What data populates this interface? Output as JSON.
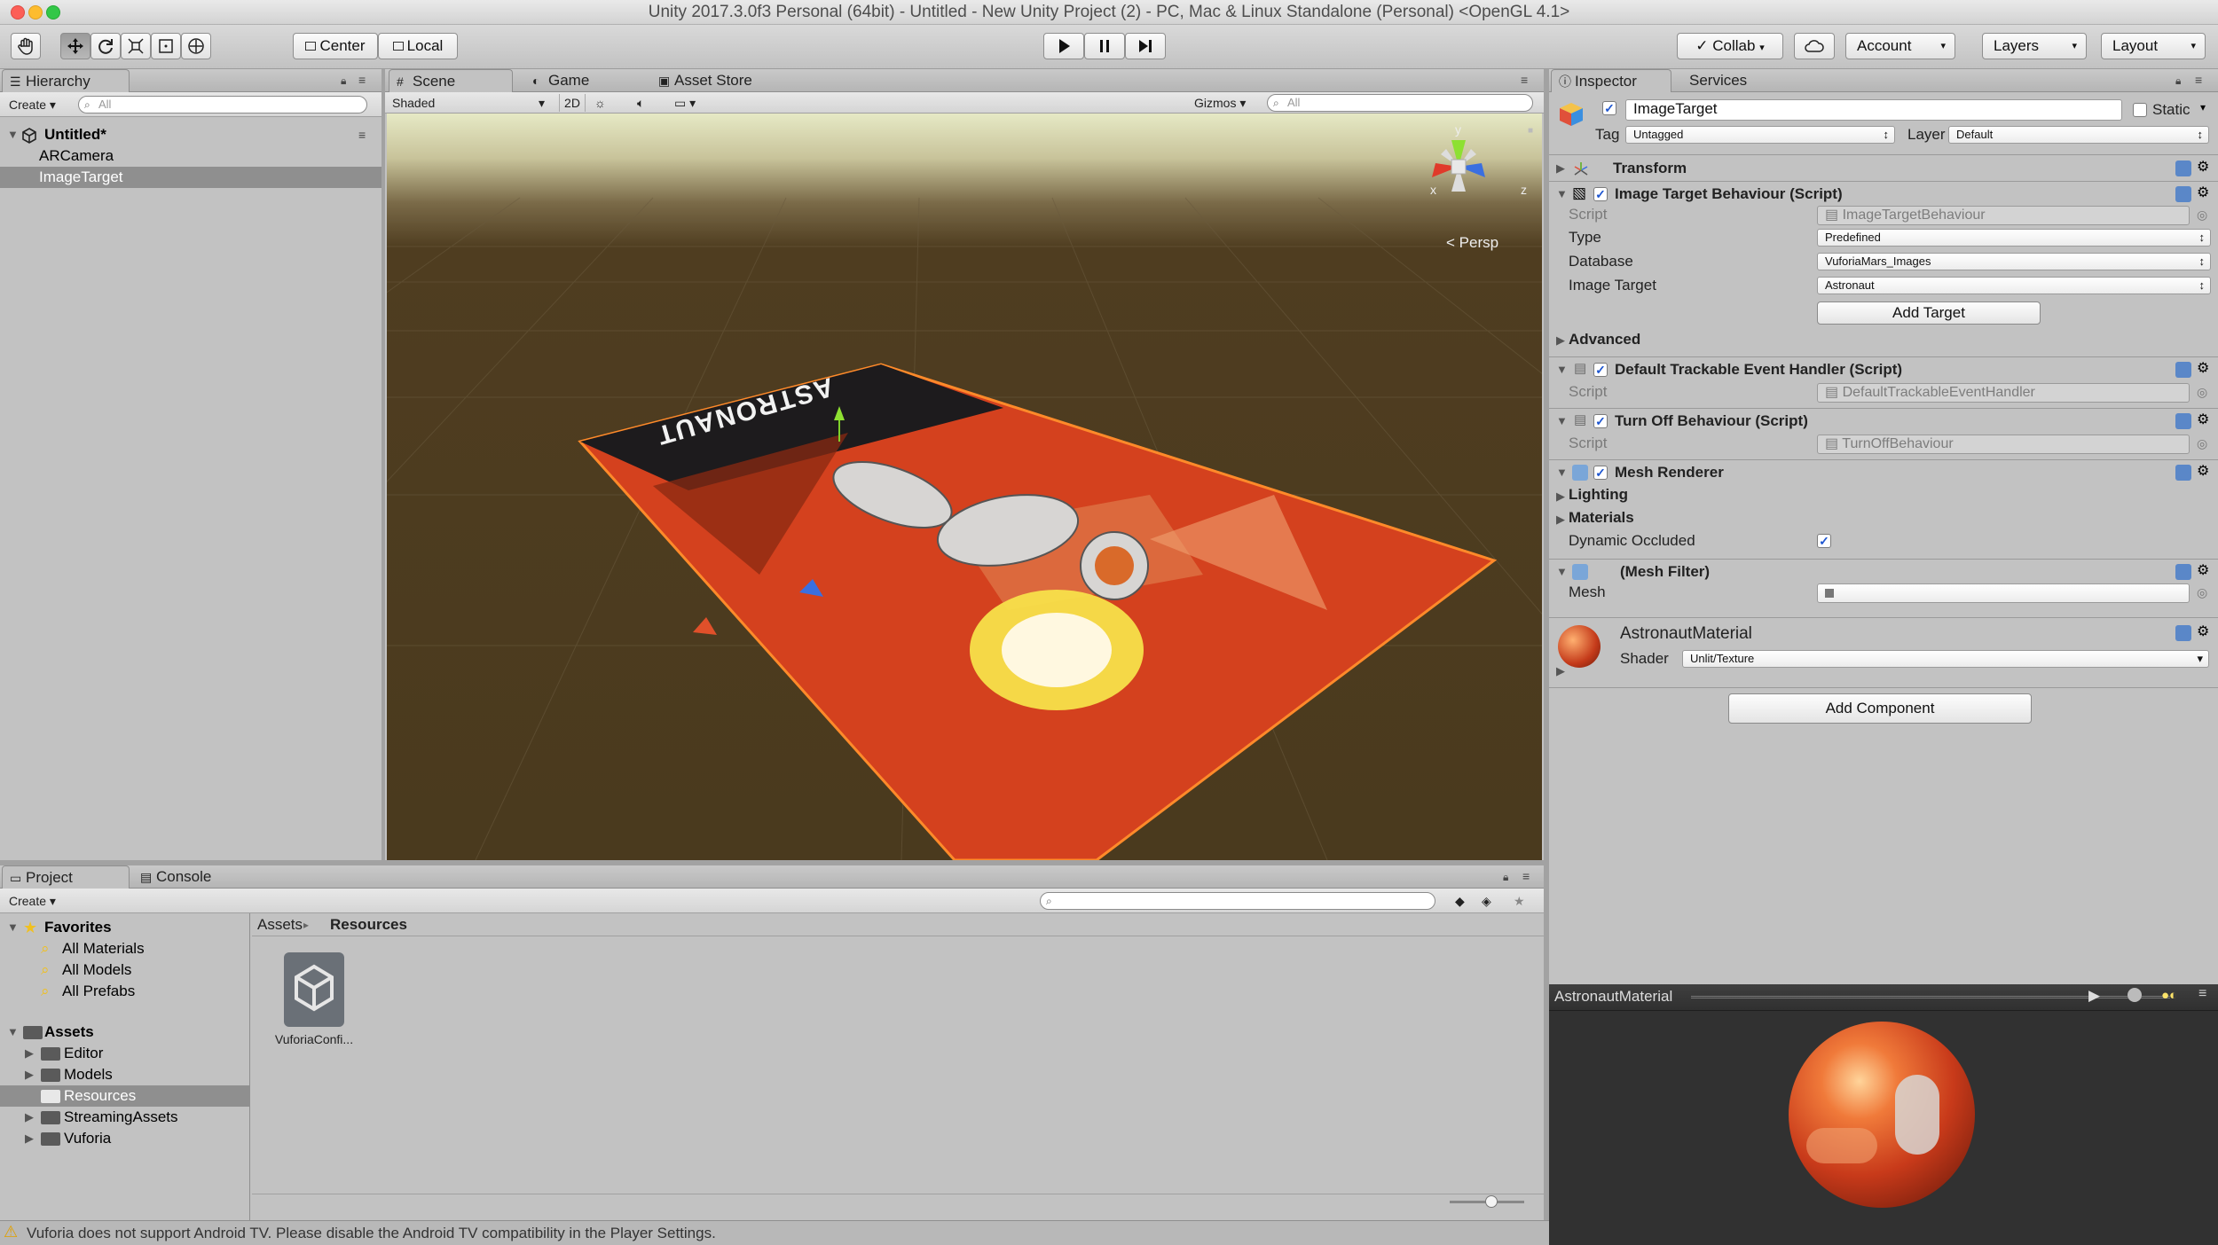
{
  "window": {
    "title": "Unity 2017.3.0f3 Personal (64bit) - Untitled - New Unity Project (2) - PC, Mac & Linux Standalone (Personal) <OpenGL 4.1>"
  },
  "toolbar": {
    "pivot": "Center",
    "space": "Local",
    "collab": "Collab",
    "account": "Account",
    "layers": "Layers",
    "layout": "Layout"
  },
  "hierarchy": {
    "tab": "Hierarchy",
    "create": "Create",
    "search_placeholder": "All",
    "scene": "Untitled*",
    "items": [
      "ARCamera",
      "ImageTarget"
    ]
  },
  "scene": {
    "tabs": [
      "Scene",
      "Game",
      "Asset Store"
    ],
    "shading": "Shaded",
    "mode_2d": "2D",
    "gizmos": "Gizmos",
    "search_placeholder": "All",
    "persp": "Persp",
    "axes": {
      "x": "x",
      "y": "y",
      "z": "z"
    },
    "card_text": "ASTRONAUT"
  },
  "inspector": {
    "tabs": [
      "Inspector",
      "Services"
    ],
    "object_name": "ImageTarget",
    "static": "Static",
    "tag_label": "Tag",
    "tag": "Untagged",
    "layer_label": "Layer",
    "layer": "Default",
    "transform": "Transform",
    "itb": {
      "title": "Image Target Behaviour (Script)",
      "script_label": "Script",
      "script": "ImageTargetBehaviour",
      "type_label": "Type",
      "type": "Predefined",
      "database_label": "Database",
      "database": "VuforiaMars_Images",
      "target_label": "Image Target",
      "target": "Astronaut",
      "add_target": "Add Target",
      "advanced": "Advanced"
    },
    "dteh": {
      "title": "Default Trackable Event Handler (Script)",
      "script_label": "Script",
      "script": "DefaultTrackableEventHandler"
    },
    "tob": {
      "title": "Turn Off Behaviour (Script)",
      "script_label": "Script",
      "script": "TurnOffBehaviour"
    },
    "mesh_renderer": {
      "title": "Mesh Renderer",
      "lighting": "Lighting",
      "materials": "Materials",
      "dynamic_occluded": "Dynamic Occluded"
    },
    "mesh_filter": {
      "title": "(Mesh Filter)",
      "mesh_label": "Mesh"
    },
    "material": {
      "name": "AstronautMaterial",
      "shader_label": "Shader",
      "shader": "Unlit/Texture"
    },
    "add_component": "Add Component",
    "preview_title": "AstronautMaterial"
  },
  "project": {
    "tabs": [
      "Project",
      "Console"
    ],
    "create": "Create",
    "favorites": "Favorites",
    "fav_items": [
      "All Materials",
      "All Models",
      "All Prefabs"
    ],
    "assets": "Assets",
    "asset_folders": [
      "Editor",
      "Models",
      "Resources",
      "StreamingAssets",
      "Vuforia"
    ],
    "breadcrumb": [
      "Assets",
      "Resources"
    ],
    "file": "VuforiaConfi..."
  },
  "status": {
    "message": "Vuforia does not support Android TV. Please disable the Android TV compatibility in the Player Settings."
  }
}
